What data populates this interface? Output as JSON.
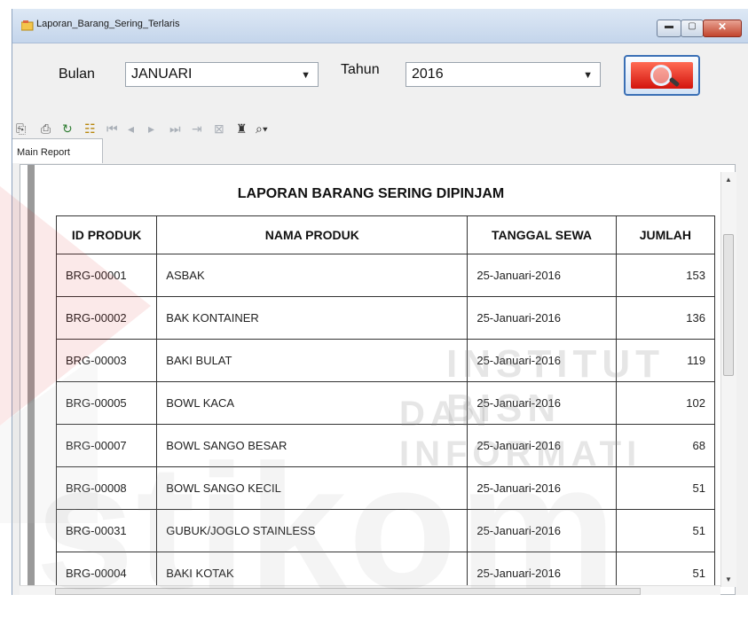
{
  "window": {
    "title": "Laporan_Barang_Sering_Terlaris"
  },
  "filters": {
    "month_label": "Bulan",
    "month_value": "JANUARI",
    "year_label": "Tahun",
    "year_value": "2016"
  },
  "search_button": {
    "icon": "magnifier-icon"
  },
  "toolbar": {
    "icons": [
      "export-icon",
      "print-icon",
      "refresh-icon",
      "group-tree-icon",
      "first-page-icon",
      "prev-page-icon",
      "next-page-icon",
      "last-page-icon",
      "goto-page-icon",
      "stop-icon",
      "find-icon",
      "zoom-icon"
    ]
  },
  "tabs": [
    {
      "label": "Main Report"
    }
  ],
  "report": {
    "title": "LAPORAN BARANG SERING DIPINJAM",
    "columns": [
      "ID PRODUK",
      "NAMA PRODUK",
      "TANGGAL SEWA",
      "JUMLAH"
    ],
    "rows": [
      {
        "id": "BRG-00001",
        "name": "ASBAK",
        "date": "25-Januari-2016",
        "qty": "153"
      },
      {
        "id": "BRG-00002",
        "name": "BAK KONTAINER",
        "date": "25-Januari-2016",
        "qty": "136"
      },
      {
        "id": "BRG-00003",
        "name": "BAKI BULAT",
        "date": "25-Januari-2016",
        "qty": "119"
      },
      {
        "id": "BRG-00005",
        "name": "BOWL KACA",
        "date": "25-Januari-2016",
        "qty": "102"
      },
      {
        "id": "BRG-00007",
        "name": "BOWL SANGO BESAR",
        "date": "25-Januari-2016",
        "qty": "68"
      },
      {
        "id": "BRG-00008",
        "name": "BOWL SANGO KECIL",
        "date": "25-Januari-2016",
        "qty": "51"
      },
      {
        "id": "BRG-00031",
        "name": "GUBUK/JOGLO STAINLESS",
        "date": "25-Januari-2016",
        "qty": "51"
      },
      {
        "id": "BRG-00004",
        "name": "BAKI KOTAK",
        "date": "25-Januari-2016",
        "qty": "51"
      }
    ]
  },
  "watermark": {
    "line1": "INSTITUT BISN",
    "line2": "DAN INFORMATI",
    "logo_text": "stikom"
  }
}
